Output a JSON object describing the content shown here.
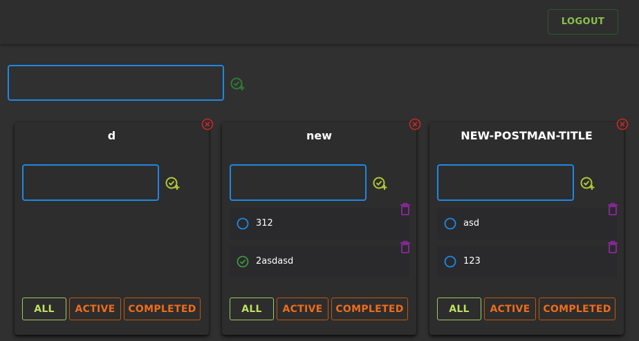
{
  "header": {
    "logout_label": "LOGOUT"
  },
  "main": {
    "new_list_value": "",
    "add_icon": "playlist-add-check-icon"
  },
  "colors": {
    "background": "#303030",
    "card": "#2d2d2d",
    "input_border": "#1e88e5",
    "add_green": "#2e7d32",
    "add_lime": "#b3c837",
    "close_red": "#c62828",
    "trash_purple": "#9c27b0",
    "filter_all": "#c0e060",
    "filter_other": "#ef6c1a"
  },
  "cards": [
    {
      "title": "d",
      "input_value": "",
      "tasks": [],
      "filters": {
        "all": "ALL",
        "active": "ACTIVE",
        "completed": "COMPLETED"
      }
    },
    {
      "title": "new",
      "input_value": "",
      "tasks": [
        {
          "text": "312",
          "done": false
        },
        {
          "text": "2asdasd",
          "done": true
        }
      ],
      "filters": {
        "all": "ALL",
        "active": "ACTIVE",
        "completed": "COMPLETED"
      }
    },
    {
      "title": "NEW-POSTMAN-TITLE",
      "input_value": "",
      "tasks": [
        {
          "text": "asd",
          "done": false
        },
        {
          "text": "123",
          "done": false
        }
      ],
      "filters": {
        "all": "ALL",
        "active": "ACTIVE",
        "completed": "COMPLETED"
      }
    }
  ]
}
